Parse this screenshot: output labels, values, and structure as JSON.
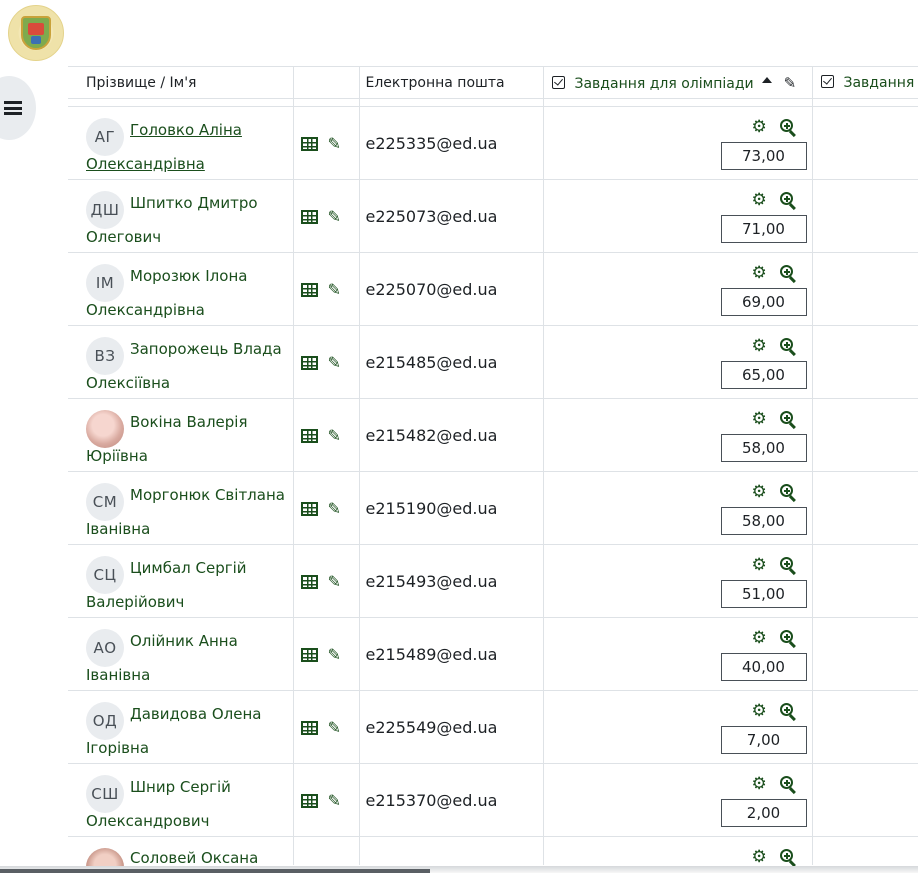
{
  "header": {
    "logo_alt": ""
  },
  "table": {
    "columns": {
      "name": "Прізвище / Ім'я",
      "email": "Електронна пошта",
      "assignment1": "Завдання для олімпіади",
      "assignment2": "Завдання для олімпіади"
    },
    "rows": [
      {
        "initials": "АГ",
        "first": "Головко Аліна",
        "last": "Олександрівна",
        "email": "e225335@ed.ua",
        "grade": "73,00",
        "photo": false
      },
      {
        "initials": "ДШ",
        "first": "Шпитко Дмитро",
        "last": "Олегович",
        "email": "e225073@ed.ua",
        "grade": "71,00",
        "photo": false
      },
      {
        "initials": "ІМ",
        "first": "Морозюк Ілона",
        "last": "Олександрівна",
        "email": "e225070@ed.ua",
        "grade": "69,00",
        "photo": false
      },
      {
        "initials": "ВЗ",
        "first": "Запорожець Влада",
        "last": "Олексіївна",
        "email": "e215485@ed.ua",
        "grade": "65,00",
        "photo": false
      },
      {
        "initials": "",
        "first": "Вокіна Валерія",
        "last": "Юріївна",
        "email": "e215482@ed.ua",
        "grade": "58,00",
        "photo": true
      },
      {
        "initials": "СМ",
        "first": "Моргонюк Світлана",
        "last": "Іванівна",
        "email": "e215190@ed.ua",
        "grade": "58,00",
        "photo": false
      },
      {
        "initials": "СЦ",
        "first": "Цимбал Сергій",
        "last": "Валерійович",
        "email": "e215493@ed.ua",
        "grade": "51,00",
        "photo": false
      },
      {
        "initials": "АО",
        "first": "Олійник Анна",
        "last": "Іванівна",
        "email": "e215489@ed.ua",
        "grade": "40,00",
        "photo": false
      },
      {
        "initials": "ОД",
        "first": "Давидова Олена",
        "last": "Ігорівна",
        "email": "e225549@ed.ua",
        "grade": "7,00",
        "photo": false
      },
      {
        "initials": "СШ",
        "first": "Шнир Сергій",
        "last": "Олександрович",
        "email": "e215370@ed.ua",
        "grade": "2,00",
        "photo": false
      }
    ],
    "partial_row": {
      "first": "Соловей Оксана"
    }
  },
  "icons": {
    "drawer": "list-icon",
    "grader": "table-icon",
    "edit": "pencil-icon",
    "settings": "cog-icon",
    "zoom": "zoom-in-icon"
  },
  "colors": {
    "link": "#1a4e1c",
    "border": "#dee2e6",
    "avatar_bg": "#e9ecef"
  }
}
